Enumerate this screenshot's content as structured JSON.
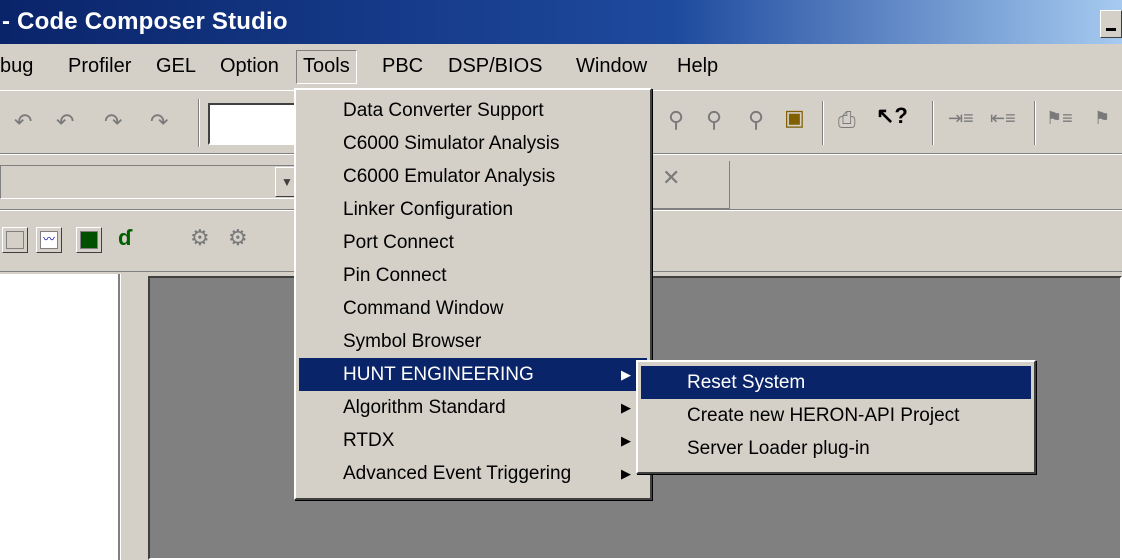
{
  "window": {
    "title": "- Code Composer Studio"
  },
  "menubar": {
    "items": [
      "bug",
      "Profiler",
      "GEL",
      "Option",
      "Tools",
      "PBC",
      "DSP/BIOS",
      "Window",
      "Help"
    ]
  },
  "toolbar": {
    "row1_left_icons": [
      "undo-icon",
      "undo-stack-icon",
      "redo-icon",
      "redo-stack-icon"
    ],
    "row1_right_icons": [
      "find-icon",
      "find-next-icon",
      "find-prev-icon",
      "find-in-files-icon",
      "print-icon",
      "context-help-icon",
      "indent-icon",
      "outdent-icon",
      "bookmark-icon",
      "bookmark-next-icon"
    ],
    "row2_icons": [
      "breakpoint-icon",
      "remove-breakpoint-icon"
    ],
    "row3_icons": [
      "graph-icon",
      "image-icon",
      "profile-icon",
      "run-icon",
      "build-icon"
    ]
  },
  "tools_menu": {
    "items": [
      {
        "label": "Data Converter Support",
        "submenu": false
      },
      {
        "label": "C6000 Simulator Analysis",
        "submenu": false
      },
      {
        "label": "C6000 Emulator Analysis",
        "submenu": false
      },
      {
        "label": "Linker Configuration",
        "submenu": false
      },
      {
        "label": "Port Connect",
        "submenu": false
      },
      {
        "label": "Pin Connect",
        "submenu": false
      },
      {
        "label": "Command Window",
        "submenu": false
      },
      {
        "label": "Symbol Browser",
        "submenu": false
      },
      {
        "label": "HUNT ENGINEERING",
        "submenu": true,
        "highlighted": true
      },
      {
        "label": "Algorithm Standard",
        "submenu": true
      },
      {
        "label": "RTDX",
        "submenu": true
      },
      {
        "label": "Advanced Event Triggering",
        "submenu": true
      }
    ]
  },
  "hunt_submenu": {
    "items": [
      {
        "label": "Reset System",
        "highlighted": true
      },
      {
        "label": "Create new HERON-API Project"
      },
      {
        "label": "Server Loader plug-in"
      }
    ]
  },
  "colors": {
    "highlight": "#0a246a",
    "face": "#d4d0c8",
    "workspace": "#808080"
  }
}
